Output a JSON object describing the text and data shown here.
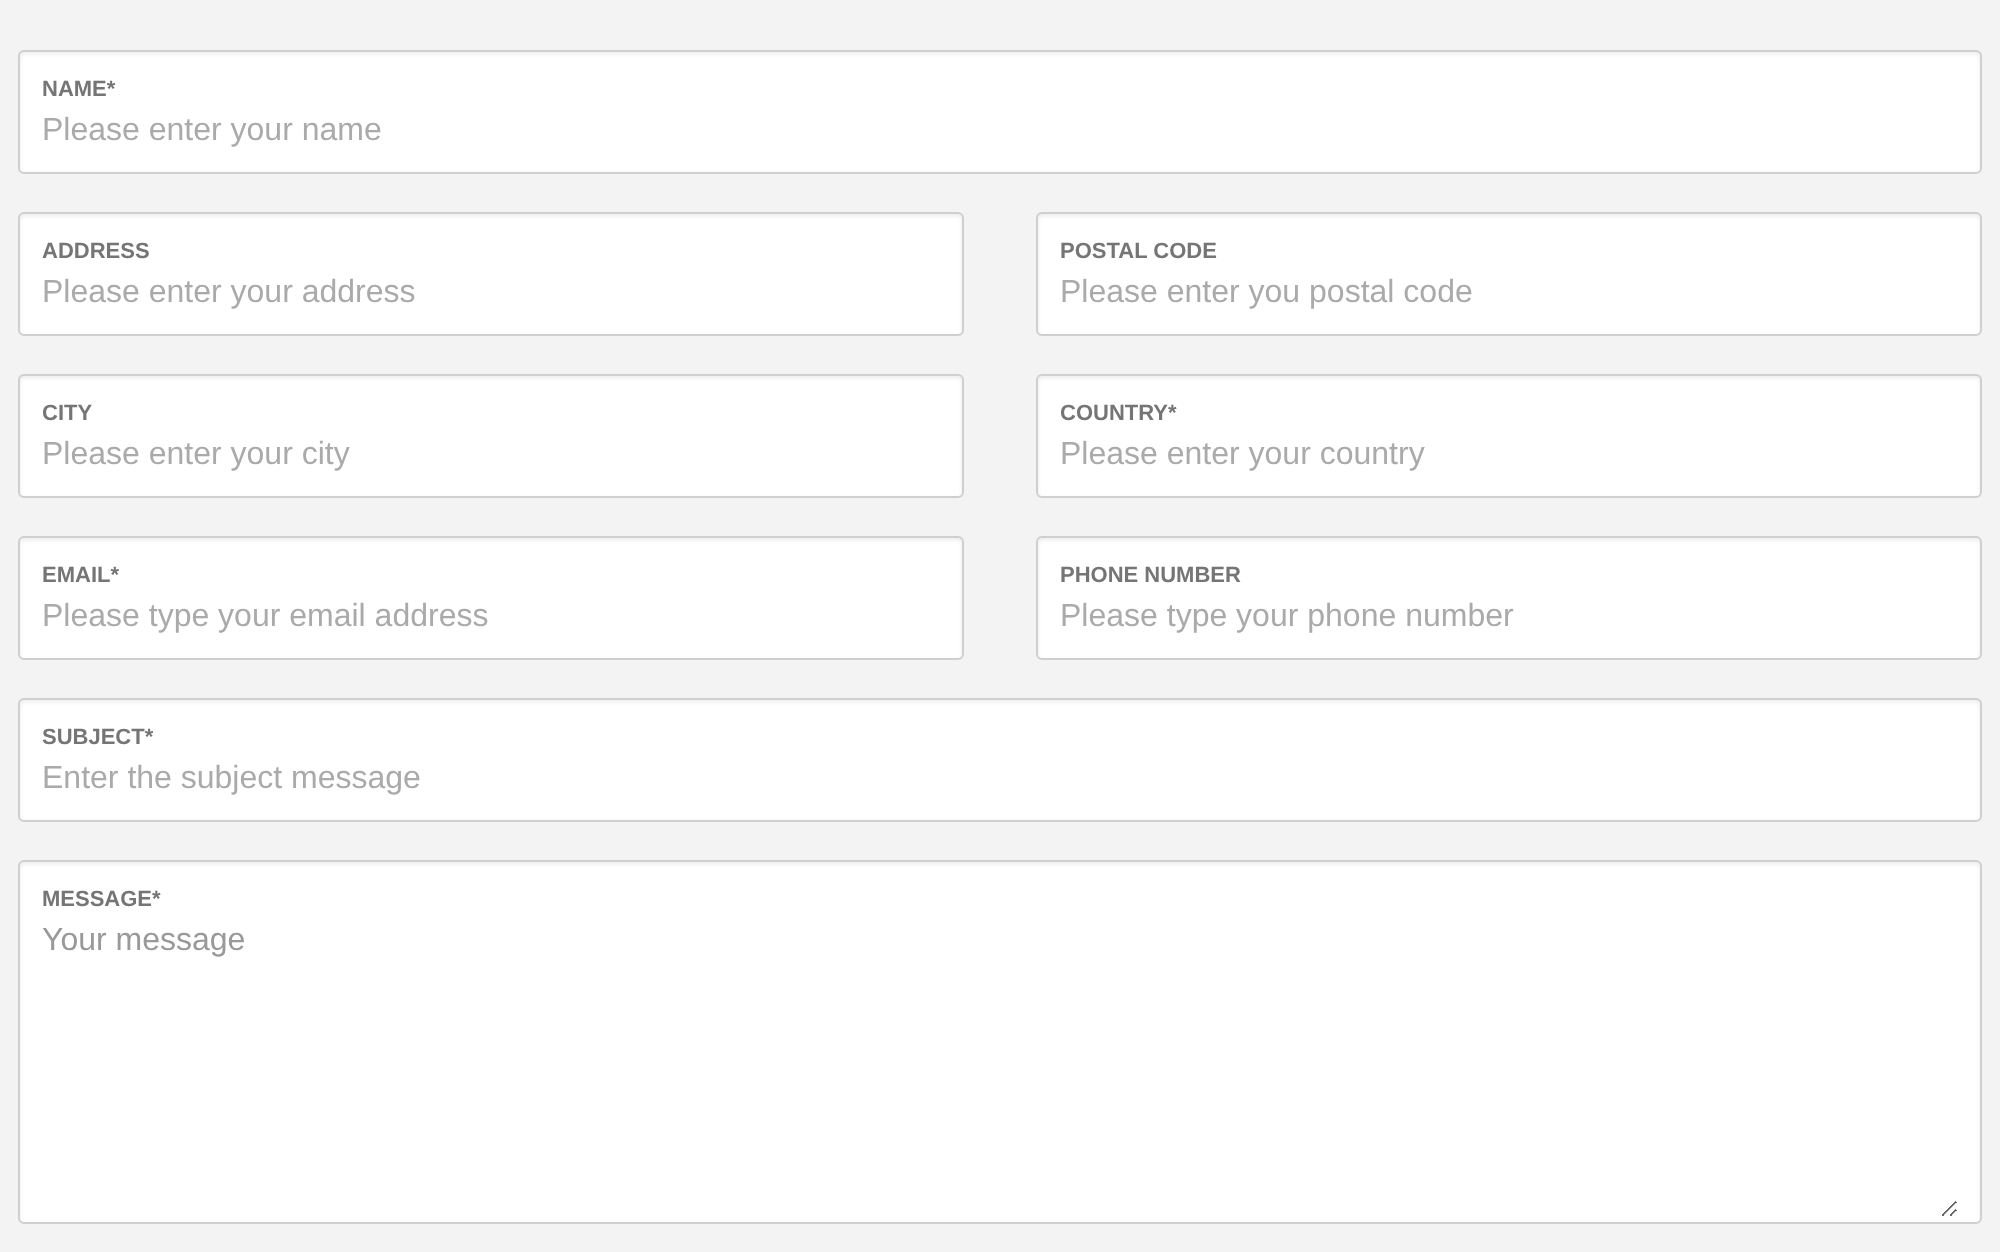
{
  "form": {
    "rows": [
      {
        "fields": [
          {
            "kind": "input",
            "label": "NAME*",
            "placeholder": "Please enter your name"
          }
        ]
      },
      {
        "fields": [
          {
            "kind": "input",
            "label": "ADDRESS",
            "placeholder": "Please enter your address"
          },
          {
            "kind": "input",
            "label": "POSTAL CODE",
            "placeholder": "Please enter you postal code"
          }
        ]
      },
      {
        "fields": [
          {
            "kind": "input",
            "label": "CITY",
            "placeholder": "Please enter your city"
          },
          {
            "kind": "input",
            "label": "COUNTRY*",
            "placeholder": "Please enter your country"
          }
        ]
      },
      {
        "fields": [
          {
            "kind": "input",
            "label": "EMAIL*",
            "placeholder": "Please type your email address"
          },
          {
            "kind": "input",
            "label": "PHONE NUMBER",
            "placeholder": "Please type your phone number"
          }
        ]
      },
      {
        "fields": [
          {
            "kind": "input",
            "label": "SUBJECT*",
            "placeholder": "Enter the subject message"
          }
        ]
      },
      {
        "fields": [
          {
            "kind": "textarea",
            "label": "MESSAGE*",
            "placeholder": "Your message"
          }
        ]
      }
    ]
  }
}
